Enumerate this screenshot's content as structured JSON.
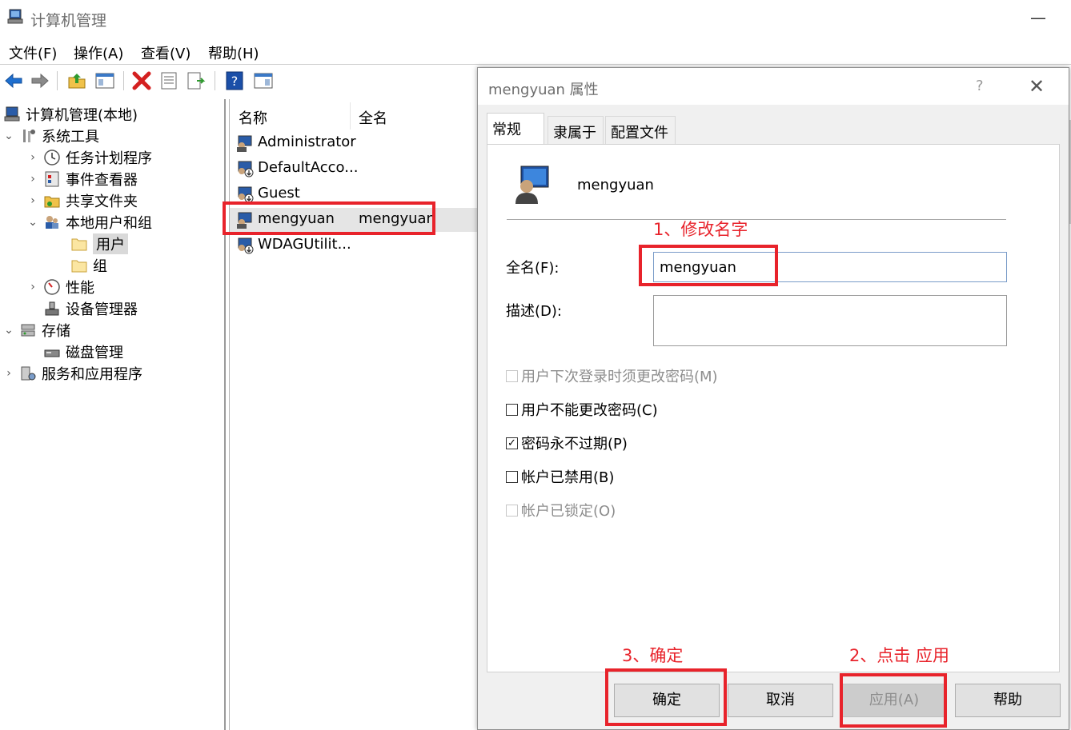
{
  "window": {
    "title": "计算机管理"
  },
  "menu": [
    "文件(F)",
    "操作(A)",
    "查看(V)",
    "帮助(H)"
  ],
  "tree": {
    "root": "计算机管理(本地)",
    "system_tools": "系统工具",
    "task_scheduler": "任务计划程序",
    "event_viewer": "事件查看器",
    "shared_folders": "共享文件夹",
    "local_users_groups": "本地用户和组",
    "users": "用户",
    "groups": "组",
    "performance": "性能",
    "device_manager": "设备管理器",
    "storage": "存储",
    "disk_management": "磁盘管理",
    "services_apps": "服务和应用程序"
  },
  "list": {
    "col_name": "名称",
    "col_fullname": "全名",
    "rows": [
      {
        "name": "Administrator",
        "full": ""
      },
      {
        "name": "DefaultAcco...",
        "full": ""
      },
      {
        "name": "Guest",
        "full": ""
      },
      {
        "name": "mengyuan",
        "full": "mengyuan"
      },
      {
        "name": "WDAGUtilit...",
        "full": ""
      }
    ]
  },
  "dialog": {
    "title": "mengyuan 属性",
    "help_glyph": "?",
    "close_glyph": "✕",
    "tabs": [
      "常规",
      "隶属于",
      "配置文件"
    ],
    "user_name": "mengyuan",
    "fullname_label": "全名(F):",
    "fullname_value": "mengyuan",
    "description_label": "描述(D):",
    "description_value": "",
    "checkboxes": [
      {
        "label": "用户下次登录时须更改密码(M)",
        "checked": false,
        "disabled": true
      },
      {
        "label": "用户不能更改密码(C)",
        "checked": false,
        "disabled": false
      },
      {
        "label": "密码永不过期(P)",
        "checked": true,
        "disabled": false
      },
      {
        "label": "帐户已禁用(B)",
        "checked": false,
        "disabled": false
      },
      {
        "label": "帐户已锁定(O)",
        "checked": false,
        "disabled": true
      }
    ],
    "buttons": {
      "ok": "确定",
      "cancel": "取消",
      "apply": "应用(A)",
      "help": "帮助"
    }
  },
  "annotations": {
    "step1": "1、修改名字",
    "step2": "2、点击 应用",
    "step3": "3、确定",
    "color": "#e8232b"
  },
  "colors": {
    "accent_blue": "#1e6fcf",
    "toolbar_red_x": "#d42020"
  }
}
